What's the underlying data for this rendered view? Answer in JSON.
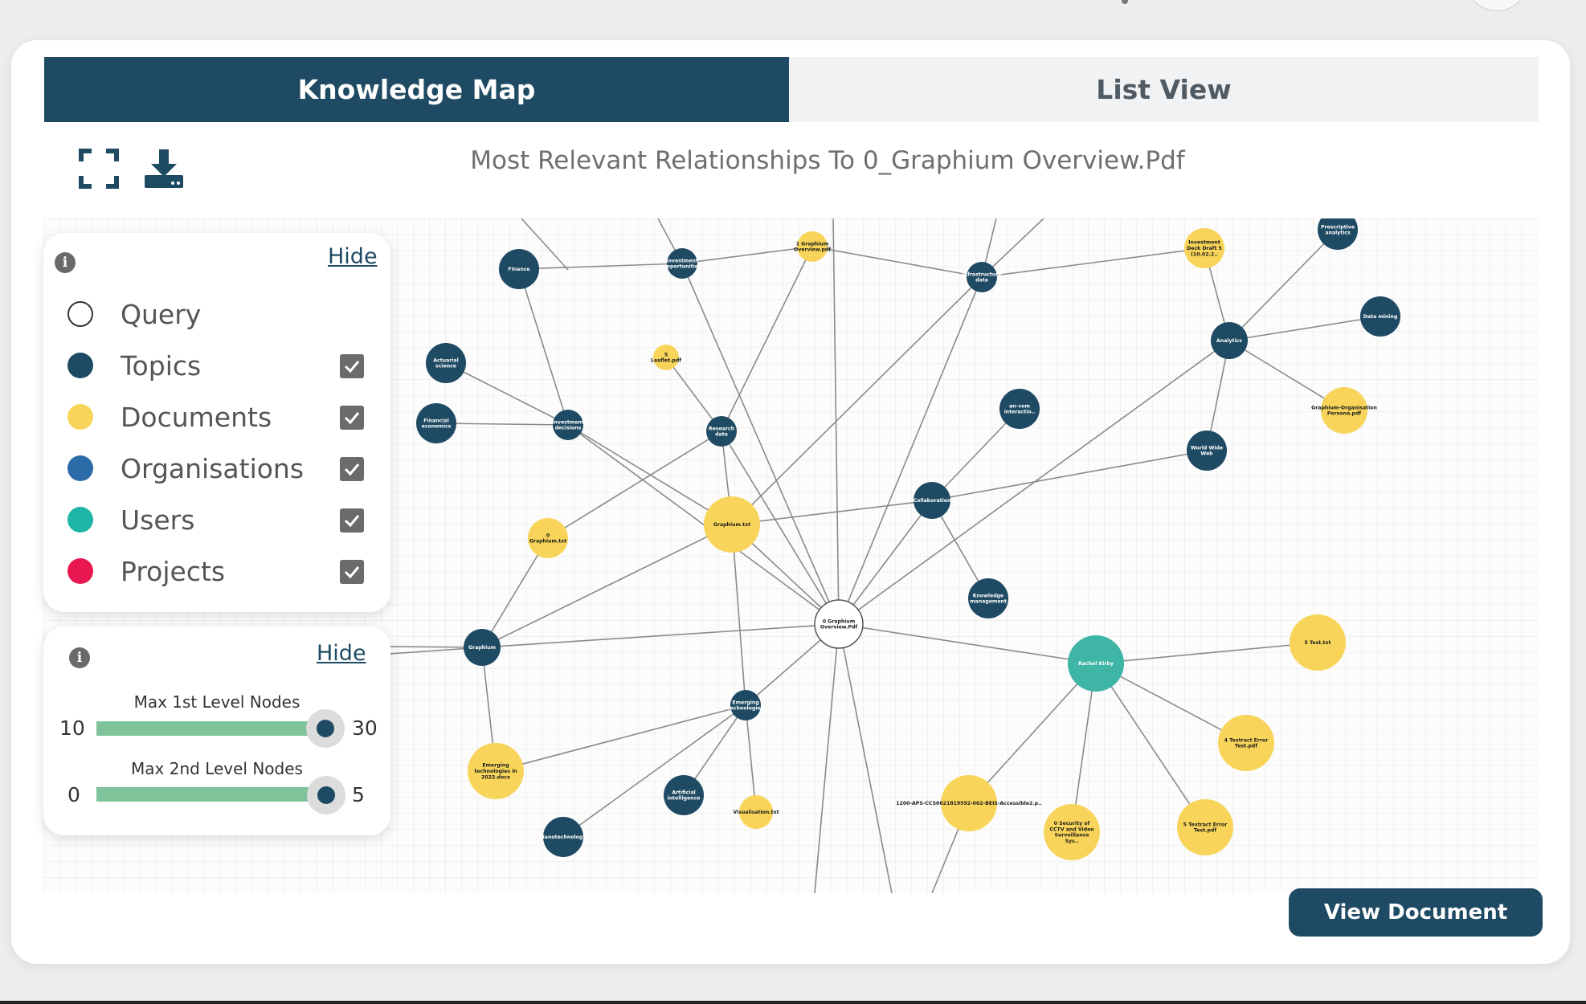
{
  "tabs": {
    "knowledge_map": "Knowledge Map",
    "list_view": "List View"
  },
  "toolbar": {
    "fullscreen_icon": "fullscreen-icon",
    "download_icon": "download-icon"
  },
  "graph": {
    "title": "Most Relevant Relationships To 0_Graphium Overview.Pdf",
    "nodes": [
      {
        "id": "center",
        "label": "0 Graphium Overview.Pdf",
        "type": "query"
      },
      {
        "id": "finance",
        "label": "Finance",
        "type": "topic"
      },
      {
        "id": "invopp",
        "label": "Investment opportunities",
        "type": "topic"
      },
      {
        "id": "g1",
        "label": "1 Graphium Overview.pdf",
        "type": "document"
      },
      {
        "id": "infra",
        "label": "Infrastructure data",
        "type": "topic"
      },
      {
        "id": "deck",
        "label": "Investment Deck Draft 5 (10.02.2..",
        "type": "document"
      },
      {
        "id": "prescr",
        "label": "Prescriptive analytics",
        "type": "topic"
      },
      {
        "id": "dm",
        "label": "Data mining",
        "type": "topic"
      },
      {
        "id": "analytics",
        "label": "Analytics",
        "type": "topic"
      },
      {
        "id": "persona",
        "label": "Graphium-Organisation Persona.pdf",
        "type": "document"
      },
      {
        "id": "www",
        "label": "World Wide Web",
        "type": "topic"
      },
      {
        "id": "actuarial",
        "label": "Actuarial science",
        "type": "topic"
      },
      {
        "id": "leaflet",
        "label": "5 Leaflet.pdf",
        "type": "document"
      },
      {
        "id": "fin_econ",
        "label": "Financial economics",
        "type": "topic"
      },
      {
        "id": "invdec",
        "label": "Investment decisions",
        "type": "topic"
      },
      {
        "id": "research",
        "label": "Research data",
        "type": "topic"
      },
      {
        "id": "interact",
        "label": "an&#x2013;com interactio..",
        "type": "topic"
      },
      {
        "id": "gtxt",
        "label": "Graphium.txt",
        "type": "document"
      },
      {
        "id": "collab",
        "label": "Collaboration",
        "type": "topic"
      },
      {
        "id": "g0txt",
        "label": "0 Graphium.txt",
        "type": "document"
      },
      {
        "id": "km",
        "label": "Knowledge management",
        "type": "topic"
      },
      {
        "id": "graphium",
        "label": "Graphium",
        "type": "topic"
      },
      {
        "id": "rachel",
        "label": "Rachel Kirby",
        "type": "user"
      },
      {
        "id": "test5",
        "label": "5 Test.txt",
        "type": "document"
      },
      {
        "id": "emerging",
        "label": "Emerging technologies",
        "type": "topic"
      },
      {
        "id": "textract4",
        "label": "4 Textract Error Test.pdf",
        "type": "document"
      },
      {
        "id": "emdoc",
        "label": "Emerging technologies in 2022.docx",
        "type": "document"
      },
      {
        "id": "ai",
        "label": "Artificial intelligence",
        "type": "topic"
      },
      {
        "id": "aps",
        "label": "1200-APS-CCS0621819592-002-BEIS-Accessible2.p..",
        "type": "document"
      },
      {
        "id": "vis",
        "label": "Visualisation.txt",
        "type": "document"
      },
      {
        "id": "nano",
        "label": "Nanotechnology",
        "type": "topic"
      },
      {
        "id": "cctv",
        "label": "0 Security of CCTV and Video Surveillance Sys..",
        "type": "document"
      },
      {
        "id": "textract5",
        "label": "5 Textract Error Test.pdf",
        "type": "document"
      }
    ]
  },
  "legend": {
    "hide_label": "Hide",
    "items": [
      {
        "label": "Query",
        "color": "#ffffff",
        "checkbox": false
      },
      {
        "label": "Topics",
        "color": "#1f4a63",
        "checkbox": true
      },
      {
        "label": "Documents",
        "color": "#f8d55a",
        "checkbox": true
      },
      {
        "label": "Organisations",
        "color": "#2a6ba8",
        "checkbox": true
      },
      {
        "label": "Users",
        "color": "#1fb5a5",
        "checkbox": true
      },
      {
        "label": "Projects",
        "color": "#e8174f",
        "checkbox": true
      }
    ]
  },
  "sliders": {
    "hide_label": "Hide",
    "first": {
      "title": "Max 1st Level Nodes",
      "min": "10",
      "max": "30",
      "value_fraction": 0.95
    },
    "second": {
      "title": "Max 2nd Level Nodes",
      "min": "0",
      "max": "5",
      "value_fraction": 1.0
    }
  },
  "actions": {
    "view_document": "View Document"
  },
  "colors": {
    "primary": "#1f4a63",
    "topic": "#1f4a63",
    "document": "#f8d55a",
    "user": "#3fb5a5",
    "query": "#ffffff",
    "slider_track": "#7fc39a",
    "edge": "#8a8a8a"
  }
}
